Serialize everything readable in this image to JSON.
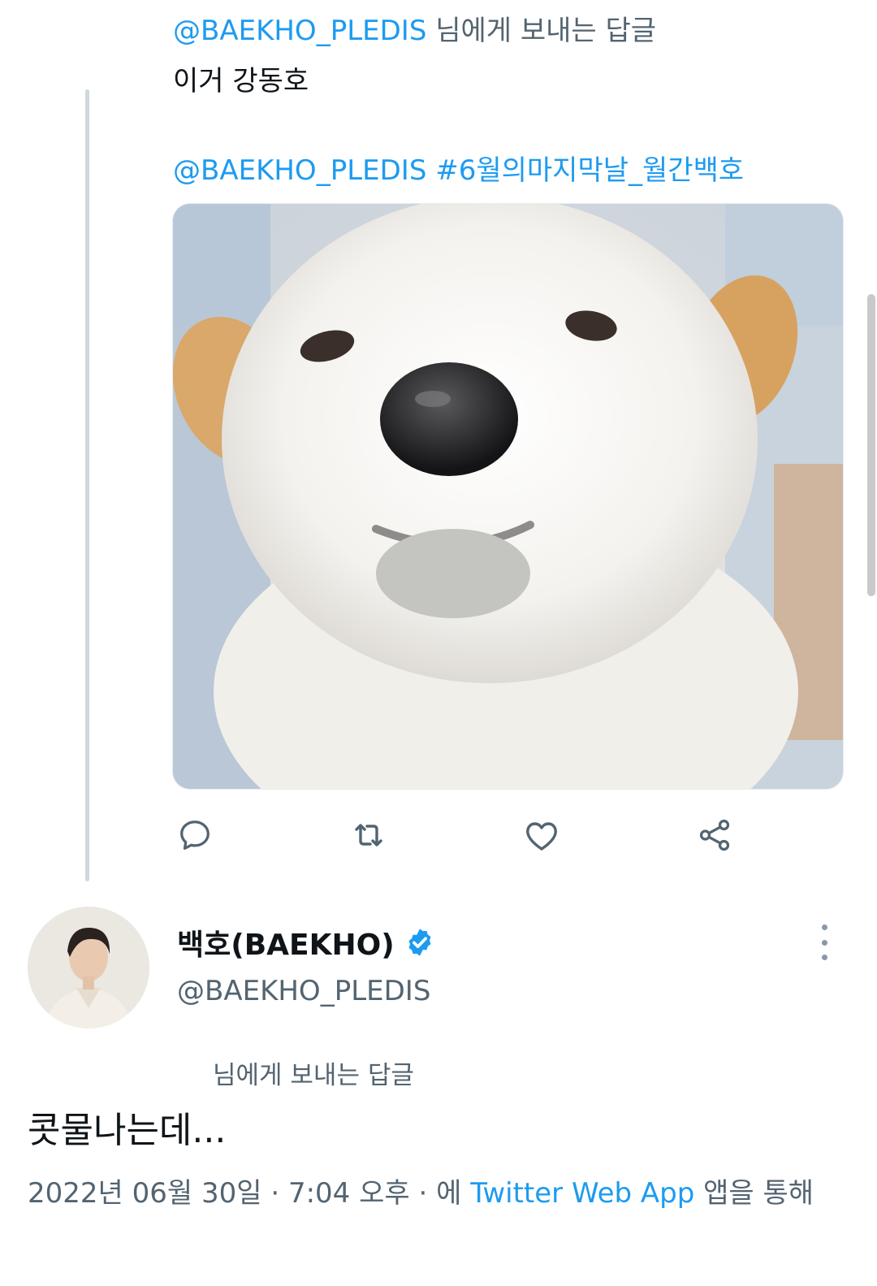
{
  "parent_tweet": {
    "reply_to_mention": "@BAEKHO_PLEDIS",
    "reply_to_suffix": " 님에게 보내는 답글",
    "text": "이거 강동호",
    "mentions": "@BAEKHO_PLEDIS #6월의마지막날_월간백호",
    "media_alt": "white puppy photo",
    "actions": {
      "reply_icon": "reply-icon",
      "retweet_icon": "retweet-icon",
      "like_icon": "heart-icon",
      "share_icon": "share-icon"
    }
  },
  "tweet": {
    "display_name": "백호(BAEKHO)",
    "verified_icon": "verified-badge-icon",
    "handle": "@BAEKHO_PLEDIS",
    "reply_to_suffix": "님에게 보내는 답글",
    "text": "콧물나는데...",
    "meta": {
      "date": "2022년 06월 30일",
      "separator1": " · ",
      "time": "7:04 오후",
      "separator2": " · ",
      "via_prefix": "에 ",
      "app": "Twitter Web App",
      "via_suffix": " 앱을 통해"
    }
  },
  "colors": {
    "link": "#1d9bf0",
    "secondary_text": "#536471",
    "primary_text": "#0f1419",
    "verified": "#1d9bf0"
  }
}
